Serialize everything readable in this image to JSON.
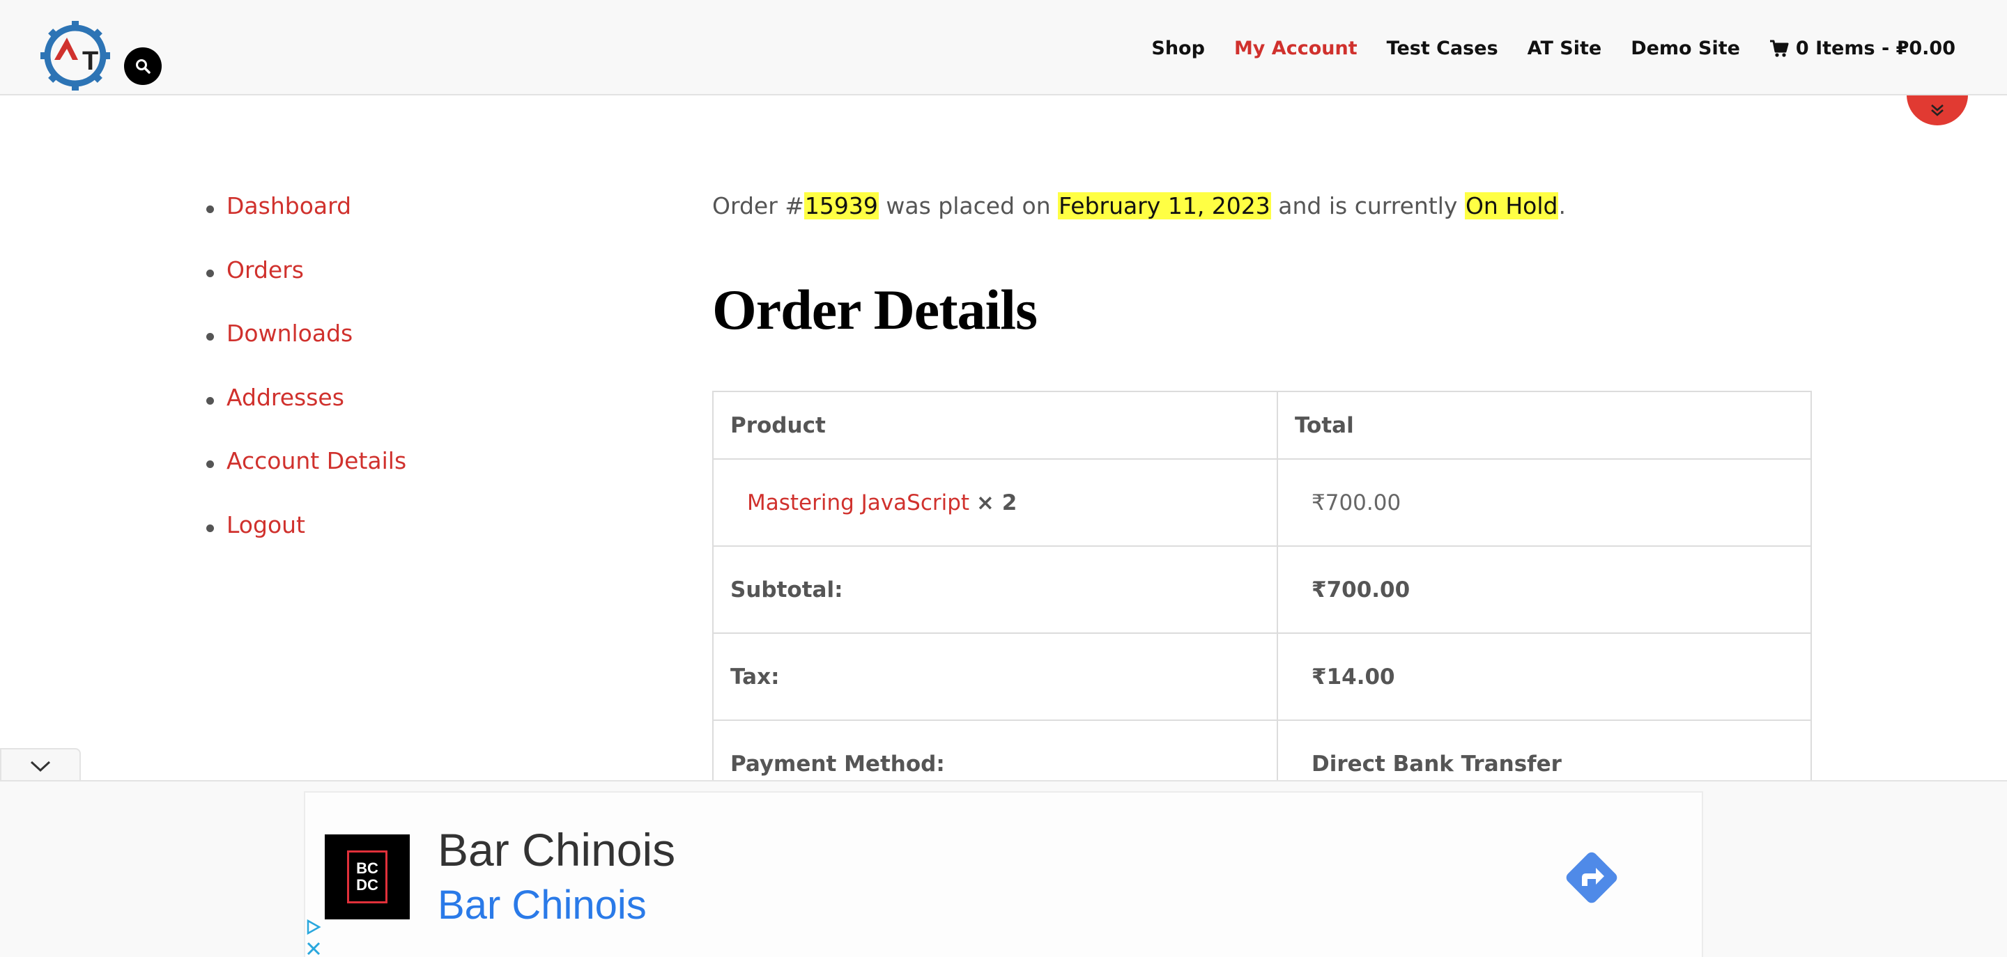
{
  "header": {
    "logo_text": "T",
    "nav": {
      "shop": "Shop",
      "my_account": "My Account",
      "test_cases": "Test Cases",
      "at_site": "AT Site",
      "demo_site": "Demo Site",
      "cart": "0 Items - ₽0.00"
    }
  },
  "account_nav": {
    "items": [
      "Dashboard",
      "Orders",
      "Downloads",
      "Addresses",
      "Account Details",
      "Logout"
    ]
  },
  "order": {
    "prefix": "Order #",
    "number": "15939",
    "placed_on_text": " was placed on ",
    "date": "February 11, 2023",
    "status_text": " and is currently ",
    "status": "On Hold",
    "suffix": "."
  },
  "order_details": {
    "title": "Order Details",
    "headers": {
      "product": "Product",
      "total": "Total"
    },
    "item": {
      "name": "Mastering JavaScript",
      "qty": "× 2",
      "price": "₹700.00"
    },
    "subtotal": {
      "label": "Subtotal:",
      "value": "₹700.00"
    },
    "tax": {
      "label": "Tax:",
      "value": "₹14.00"
    },
    "payment": {
      "label": "Payment Method:",
      "value": "Direct Bank Transfer"
    }
  },
  "ad": {
    "logo_top": "BC",
    "logo_bottom": "DC",
    "title": "Bar Chinois",
    "subtitle": "Bar Chinois"
  },
  "colors": {
    "accent": "#d0312d",
    "highlight": "#ffff44",
    "ad_link": "#2a7ae8"
  }
}
